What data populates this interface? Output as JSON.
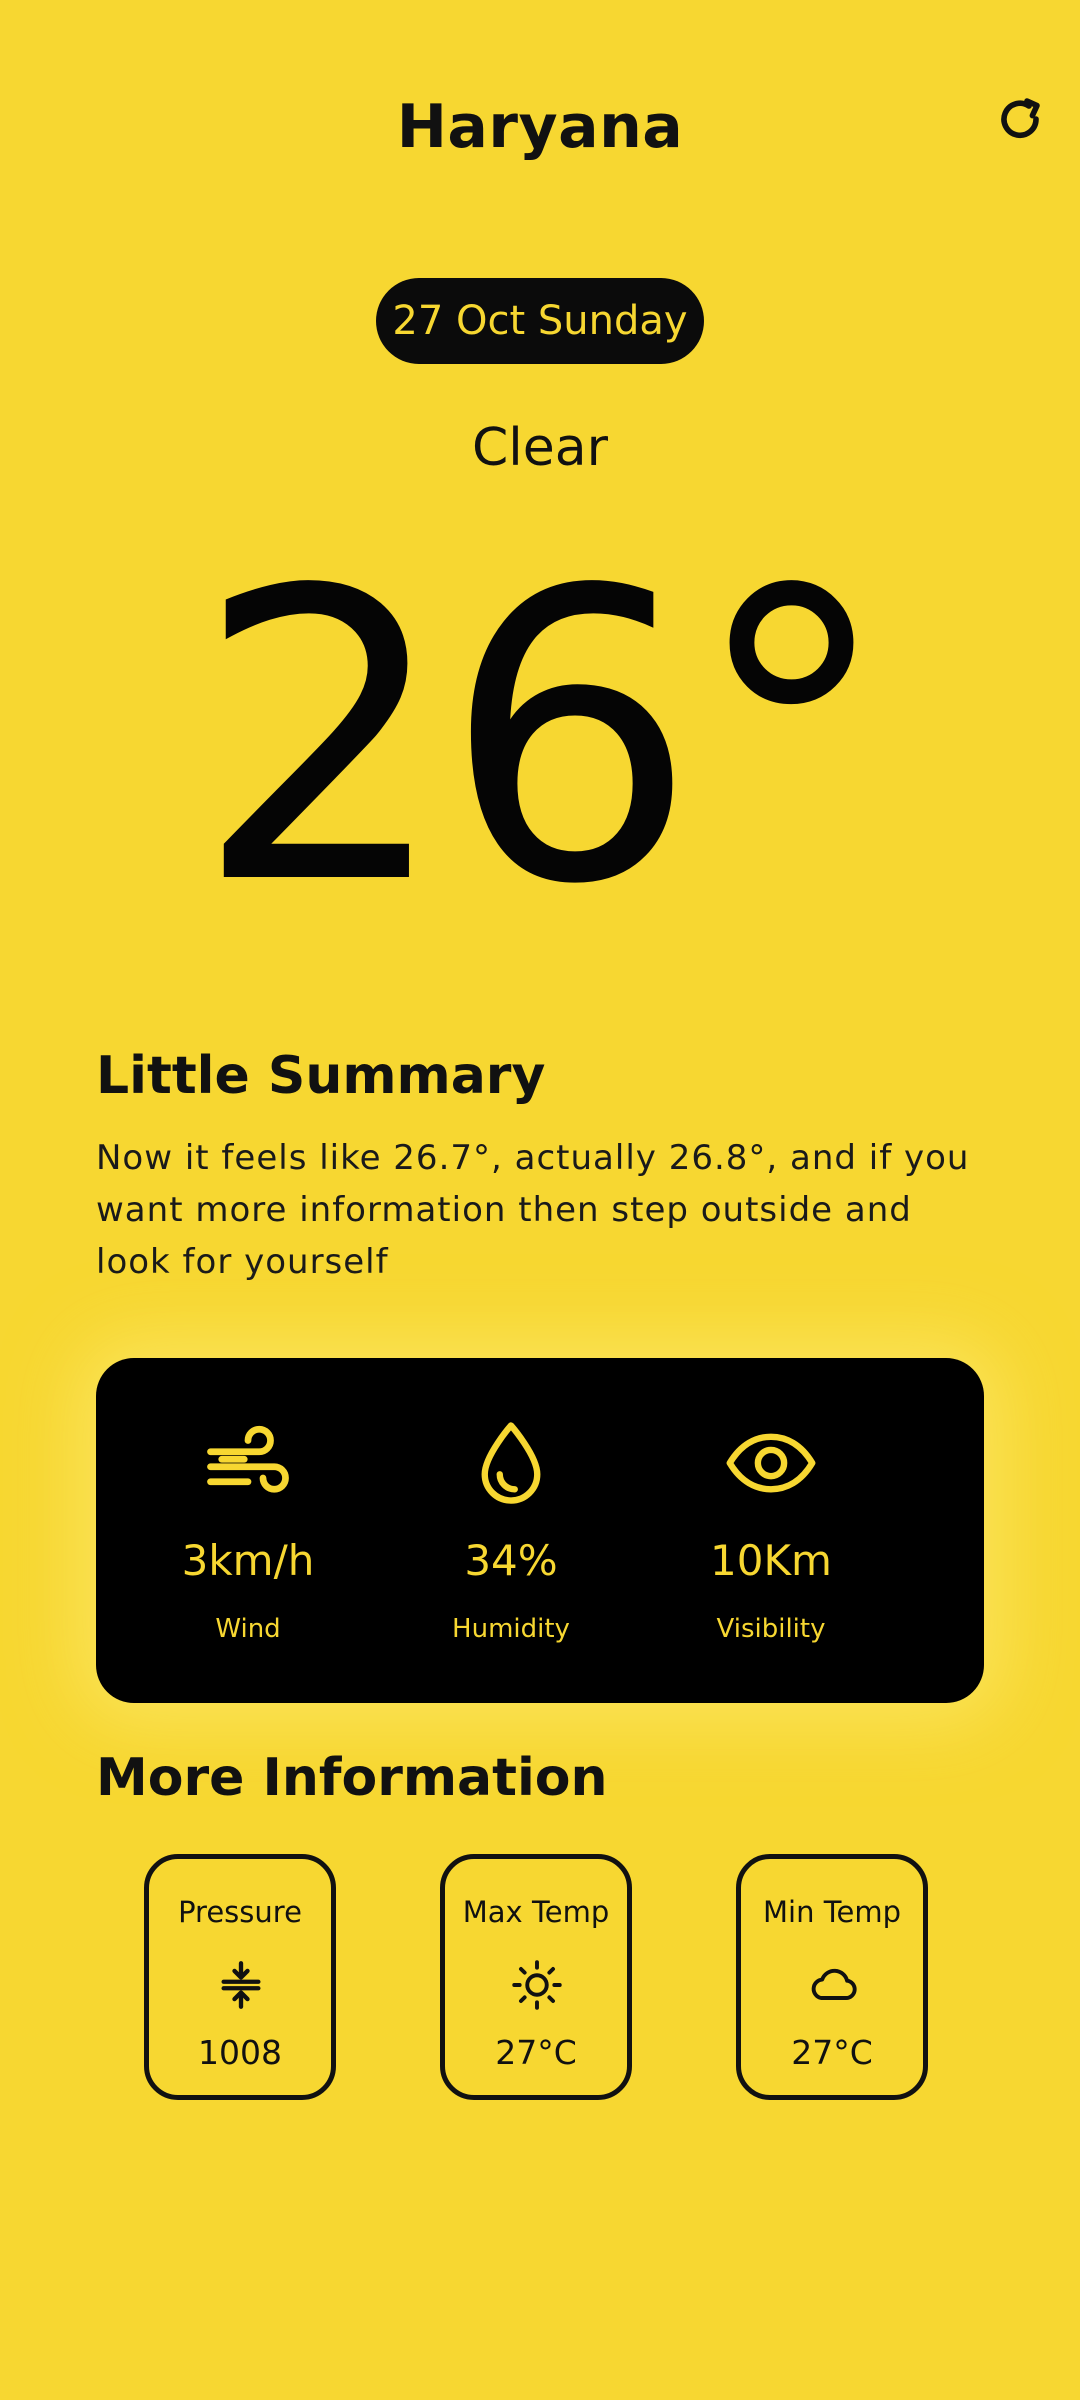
{
  "header": {
    "city": "Haryana",
    "refresh_icon": "refresh-icon"
  },
  "date": "27 Oct Sunday",
  "condition": "Clear",
  "temperature": "26°",
  "summary": {
    "title": "Little Summary",
    "text": "Now it feels like 26.7°, actually 26.8°, and if you want more information then step outside and look for yourself"
  },
  "stats": [
    {
      "icon": "wind-icon",
      "value": "3km/h",
      "label": "Wind"
    },
    {
      "icon": "humidity-drop-icon",
      "value": "34%",
      "label": "Humidity"
    },
    {
      "icon": "eye-icon",
      "value": "10Km",
      "label": "Visibility"
    }
  ],
  "more_info": {
    "title": "More Information",
    "cards": [
      {
        "title": "Pressure",
        "icon": "pressure-compress-icon",
        "value": "1008"
      },
      {
        "title": "Max Temp",
        "icon": "sun-icon",
        "value": "27°C"
      },
      {
        "title": "Min Temp",
        "icon": "cloud-icon",
        "value": "27°C"
      }
    ]
  },
  "colors": {
    "background": "#F7D731",
    "accent": "#F7D731",
    "dark": "#000000"
  }
}
